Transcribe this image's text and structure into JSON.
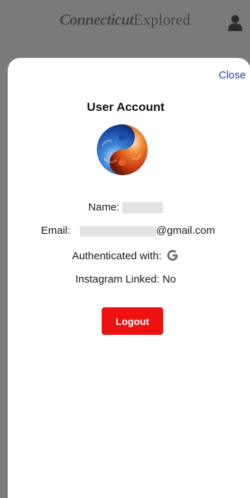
{
  "app_header": {
    "brand_part1": "Connecticut",
    "brand_part2": "Explored",
    "user_icon": "user-icon"
  },
  "modal": {
    "close_label": "Close",
    "title": "User Account",
    "avatar_icon": "yin-yang-avatar",
    "name_label": "Name:",
    "email_label": "Email:",
    "email_domain": "@gmail.com",
    "auth_label": "Authenticated with:",
    "auth_provider_icon": "google-icon",
    "instagram_label": "Instagram Linked: No",
    "logout_label": "Logout"
  },
  "colors": {
    "accent_link": "#1f3fb3",
    "logout_button": "#ee1111",
    "overlay": "#7a7a7a"
  }
}
